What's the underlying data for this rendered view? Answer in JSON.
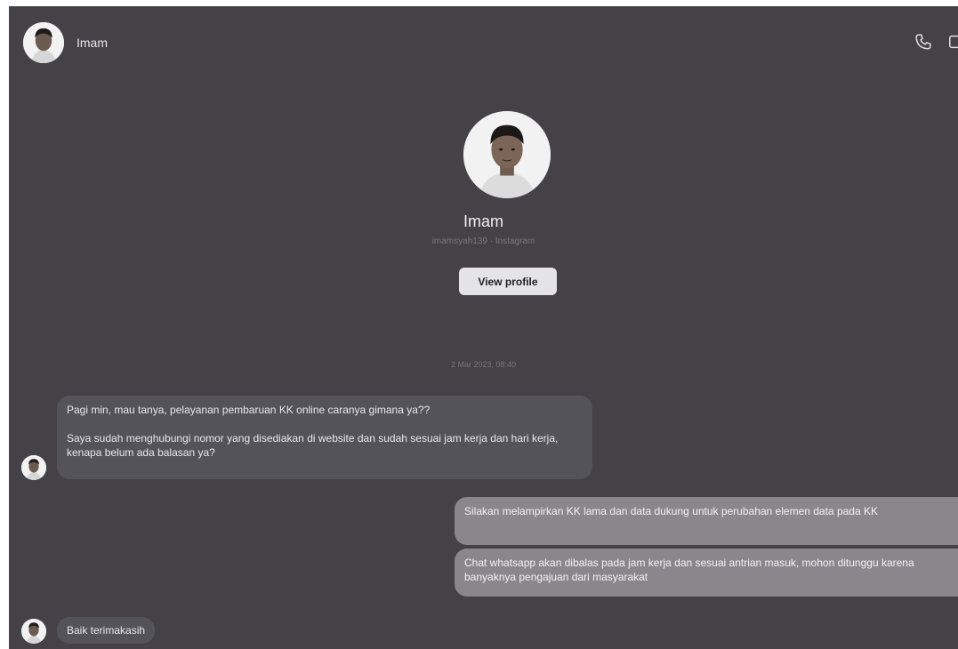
{
  "header": {
    "contact_name": "Imam",
    "icons": [
      "avatar",
      "phone-icon",
      "video-call-icon"
    ]
  },
  "profile": {
    "name": "Imam",
    "handle": "imamsyah139 · Instagram",
    "view_profile_label": "View profile"
  },
  "conversation": {
    "timestamp": "2 Mar 2023, 08:40",
    "messages": [
      {
        "direction": "incoming",
        "paragraphs": [
          "Pagi min, mau tanya, pelayanan pembaruan KK online caranya gimana ya??",
          "Saya sudah menghubungi nomor yang disediakan di website dan sudah sesuai jam kerja dan hari kerja, kenapa belum ada balasan ya?"
        ]
      },
      {
        "direction": "outgoing",
        "text": "Silakan melampirkan KK lama dan data dukung untuk perubahan elemen data pada KK"
      },
      {
        "direction": "outgoing",
        "text": "Chat whatsapp akan dibalas pada jam kerja dan sesuai antrian masuk, mohon ditunggu karena banyaknya pengajuan dari masyarakat"
      },
      {
        "direction": "incoming",
        "text": "Baik terimakasih"
      }
    ]
  },
  "colors": {
    "background": "#444247",
    "incoming_bubble": "#55535a",
    "outgoing_bubble": "#89878c",
    "button": "#e4e4e6"
  }
}
